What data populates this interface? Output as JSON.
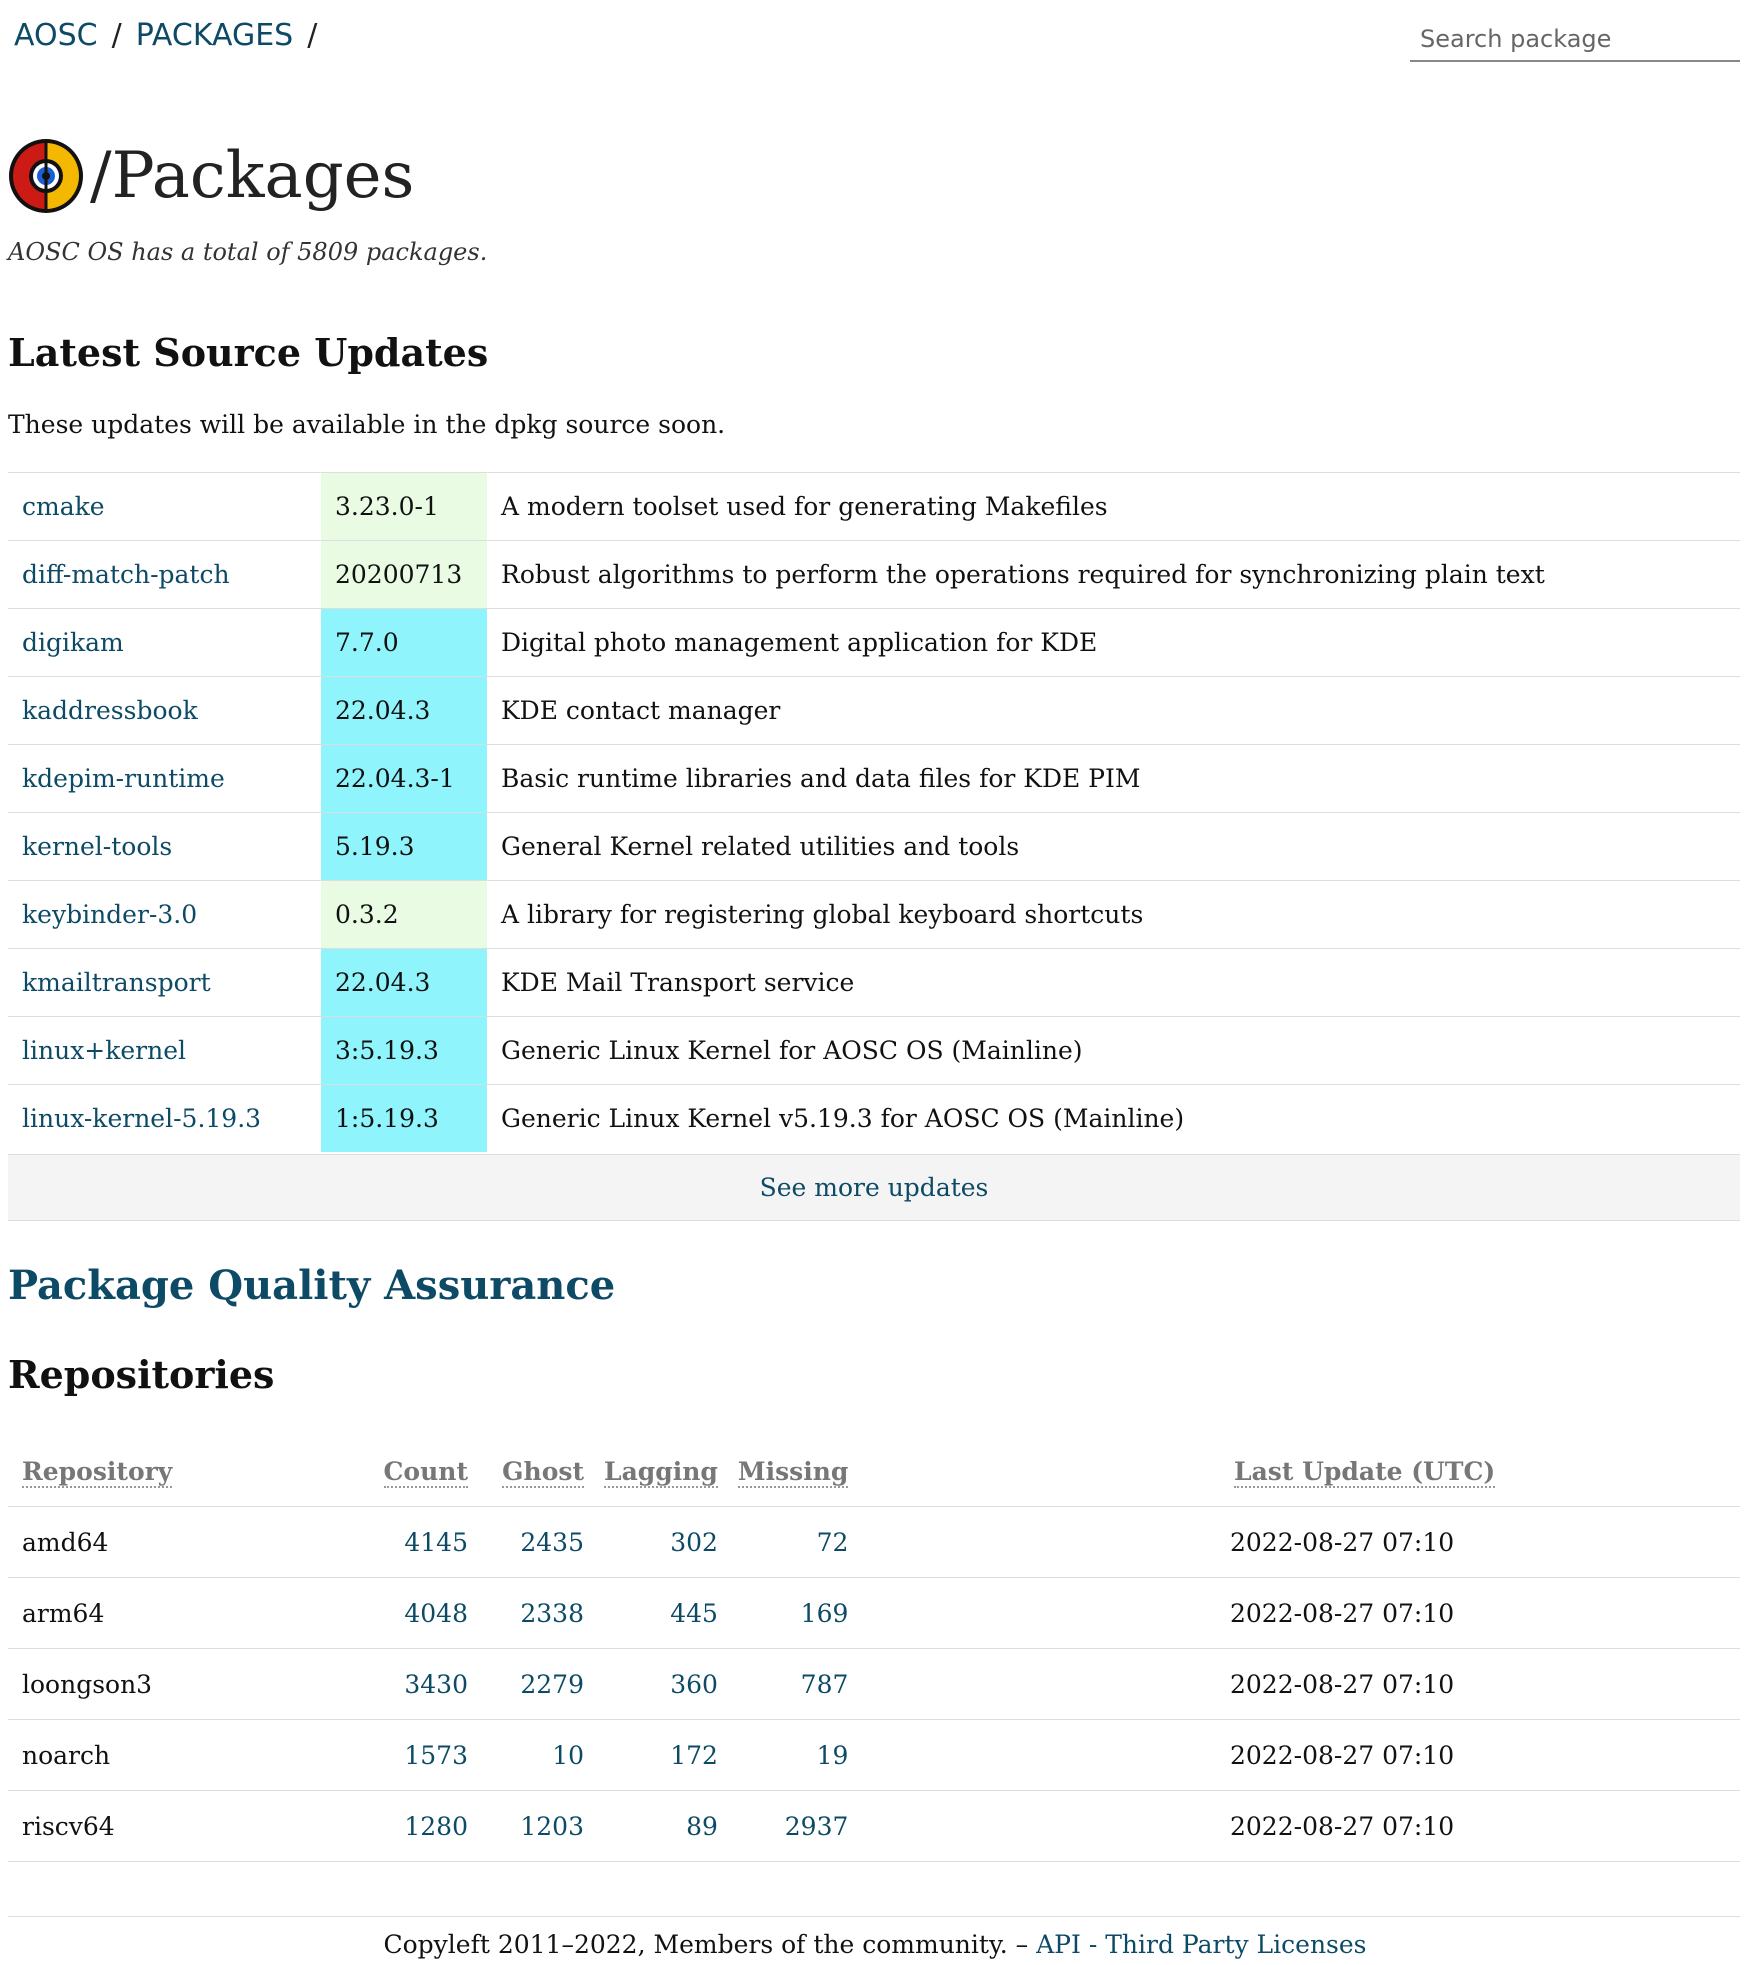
{
  "breadcrumb": {
    "root": "AOSC",
    "packages": "PACKAGES",
    "sep": "/"
  },
  "search": {
    "placeholder": "Search package"
  },
  "title": "/Packages",
  "summary": "AOSC OS has a total of 5809 packages.",
  "updates": {
    "heading": "Latest Source Updates",
    "intro": "These updates will be available in the dpkg source soon.",
    "rows": [
      {
        "name": "cmake",
        "version": "3.23.0-1",
        "desc": "A modern toolset used for generating Makefiles",
        "status": "green"
      },
      {
        "name": "diff-match-patch",
        "version": "20200713",
        "desc": "Robust algorithms to perform the operations required for synchronizing plain text",
        "status": "green"
      },
      {
        "name": "digikam",
        "version": "7.7.0",
        "desc": "Digital photo management application for KDE",
        "status": "cyan"
      },
      {
        "name": "kaddressbook",
        "version": "22.04.3",
        "desc": "KDE contact manager",
        "status": "cyan"
      },
      {
        "name": "kdepim-runtime",
        "version": "22.04.3-1",
        "desc": "Basic runtime libraries and data files for KDE PIM",
        "status": "cyan"
      },
      {
        "name": "kernel-tools",
        "version": "5.19.3",
        "desc": "General Kernel related utilities and tools",
        "status": "cyan"
      },
      {
        "name": "keybinder-3.0",
        "version": "0.3.2",
        "desc": "A library for registering global keyboard shortcuts",
        "status": "green"
      },
      {
        "name": "kmailtransport",
        "version": "22.04.3",
        "desc": "KDE Mail Transport service",
        "status": "cyan"
      },
      {
        "name": "linux+kernel",
        "version": "3:5.19.3",
        "desc": "Generic Linux Kernel for AOSC OS (Mainline)",
        "status": "cyan"
      },
      {
        "name": "linux-kernel-5.19.3",
        "version": "1:5.19.3",
        "desc": "Generic Linux Kernel v5.19.3 for AOSC OS (Mainline)",
        "status": "cyan"
      }
    ],
    "see_more": "See more updates"
  },
  "qa_link": "Package Quality Assurance",
  "repos": {
    "heading": "Repositories",
    "columns": {
      "repo": "Repository",
      "count": "Count",
      "ghost": "Ghost",
      "lagging": "Lagging",
      "missing": "Missing",
      "updated": "Last Update (UTC)"
    },
    "rows": [
      {
        "repo": "amd64",
        "count": "4145",
        "ghost": "2435",
        "lagging": "302",
        "missing": "72",
        "updated": "2022-08-27 07:10"
      },
      {
        "repo": "arm64",
        "count": "4048",
        "ghost": "2338",
        "lagging": "445",
        "missing": "169",
        "updated": "2022-08-27 07:10"
      },
      {
        "repo": "loongson3",
        "count": "3430",
        "ghost": "2279",
        "lagging": "360",
        "missing": "787",
        "updated": "2022-08-27 07:10"
      },
      {
        "repo": "noarch",
        "count": "1573",
        "ghost": "10",
        "lagging": "172",
        "missing": "19",
        "updated": "2022-08-27 07:10"
      },
      {
        "repo": "riscv64",
        "count": "1280",
        "ghost": "1203",
        "lagging": "89",
        "missing": "2937",
        "updated": "2022-08-27 07:10"
      }
    ]
  },
  "footer": {
    "text": "Copyleft 2011–2022, Members of the community. –",
    "api": "API",
    "dash": "-",
    "licenses": "Third Party Licenses"
  },
  "colors": {
    "link": "#0d4a66",
    "version_green": "#e9fbe3",
    "version_cyan": "#8ff4fb",
    "logo_red": "#cc1a14",
    "logo_yellow": "#f5b800",
    "logo_blue": "#1c5fd1"
  },
  "icons": {
    "logo": "aosc-logo-icon"
  }
}
